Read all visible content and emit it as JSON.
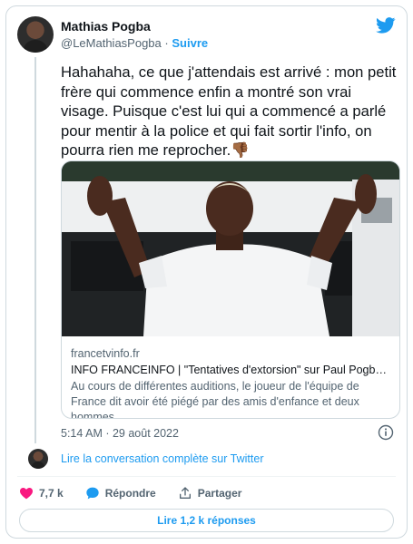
{
  "author": {
    "name": "Mathias Pogba",
    "handle": "@LeMathiasPogba",
    "separator": "·",
    "follow_label": "Suivre"
  },
  "tweet": {
    "text": "Hahahaha, ce que j'attendais est arrivé : mon petit frère qui commence enfin a montré son vrai visage. Puisque c'est lui qui a commencé a parlé pour mentir à la police et qui fait sortir l'info, on pourra rien me reprocher.",
    "emoji": "👎🏾",
    "timestamp": "5:14 AM · 29 août 2022"
  },
  "link_card": {
    "domain": "francetvinfo.fr",
    "title": "INFO FRANCEINFO | \"Tentatives d'extorsion\" sur Paul Pogba : le f...",
    "description": "Au cours de différentes auditions, le joueur de l'équipe de France dit avoir été piégé par des amis d'enfance et deux hommes ..."
  },
  "conversation": {
    "link_label": "Lire la conversation complète sur Twitter"
  },
  "actions": {
    "likes": "7,7 k",
    "reply_label": "Répondre",
    "share_label": "Partager"
  },
  "replies_button": {
    "label": "Lire 1,2 k réponses"
  },
  "colors": {
    "accent": "#1d9bf0",
    "like": "#f91880",
    "muted": "#536471",
    "border": "#cfd9de"
  },
  "icons": [
    "twitter-bird-icon",
    "info-icon",
    "heart-icon",
    "reply-bubble-icon",
    "share-icon"
  ]
}
